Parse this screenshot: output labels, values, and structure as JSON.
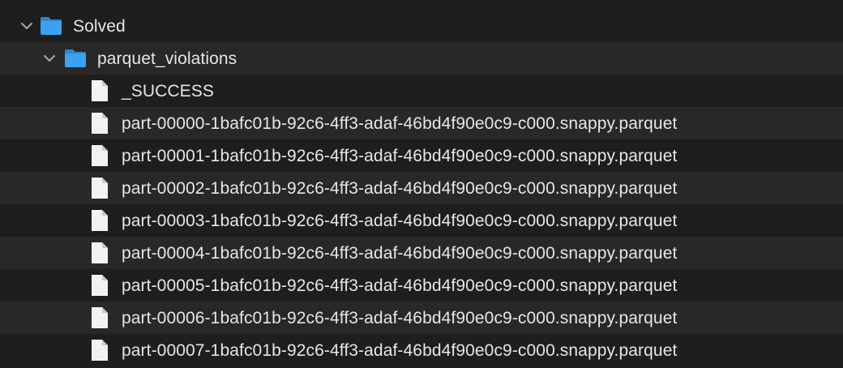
{
  "tree": {
    "root": {
      "label": "Solved",
      "expanded": true,
      "icon": "folder-icon"
    },
    "child_folder": {
      "label": "parquet_violations",
      "expanded": true,
      "icon": "folder-icon"
    },
    "files": [
      {
        "label": "_SUCCESS",
        "icon": "file-icon"
      },
      {
        "label": "part-00000-1bafc01b-92c6-4ff3-adaf-46bd4f90e0c9-c000.snappy.parquet",
        "icon": "file-icon"
      },
      {
        "label": "part-00001-1bafc01b-92c6-4ff3-adaf-46bd4f90e0c9-c000.snappy.parquet",
        "icon": "file-icon"
      },
      {
        "label": "part-00002-1bafc01b-92c6-4ff3-adaf-46bd4f90e0c9-c000.snappy.parquet",
        "icon": "file-icon"
      },
      {
        "label": "part-00003-1bafc01b-92c6-4ff3-adaf-46bd4f90e0c9-c000.snappy.parquet",
        "icon": "file-icon"
      },
      {
        "label": "part-00004-1bafc01b-92c6-4ff3-adaf-46bd4f90e0c9-c000.snappy.parquet",
        "icon": "file-icon"
      },
      {
        "label": "part-00005-1bafc01b-92c6-4ff3-adaf-46bd4f90e0c9-c000.snappy.parquet",
        "icon": "file-icon"
      },
      {
        "label": "part-00006-1bafc01b-92c6-4ff3-adaf-46bd4f90e0c9-c000.snappy.parquet",
        "icon": "file-icon"
      },
      {
        "label": "part-00007-1bafc01b-92c6-4ff3-adaf-46bd4f90e0c9-c000.snappy.parquet",
        "icon": "file-icon"
      }
    ]
  },
  "colors": {
    "background": "#1e1e1e",
    "alt_row": "#282828",
    "text": "#e6e6e6",
    "folder_blue": "#3aa2f0",
    "file_white": "#f2f2f2"
  }
}
